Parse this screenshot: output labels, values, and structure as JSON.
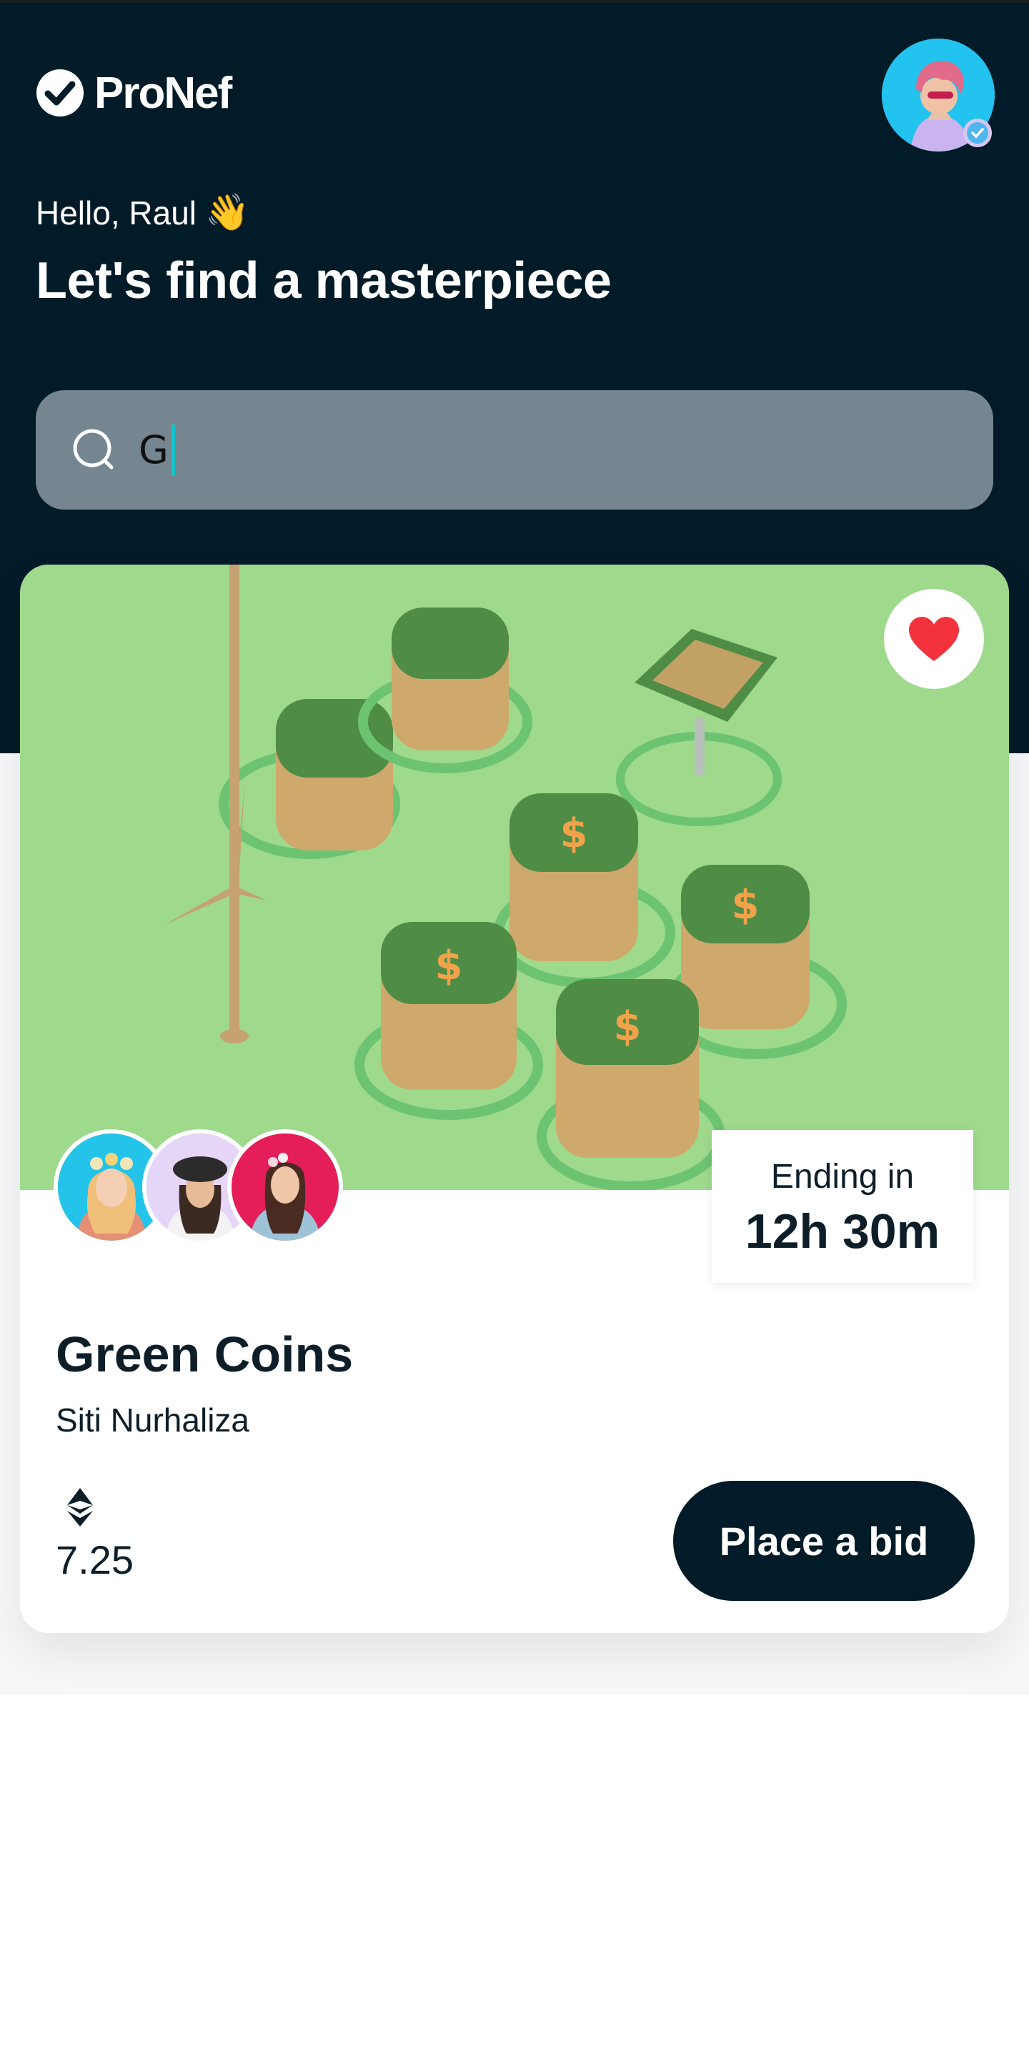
{
  "app": {
    "brand_name": "ProNef"
  },
  "header": {
    "greeting": "Hello, Raul",
    "greeting_emoji": "👋",
    "headline": "Let's find a masterpiece"
  },
  "search": {
    "value": "G"
  },
  "card": {
    "title": "Green Coins",
    "creator": "Siti Nurhaliza",
    "price": "7.25",
    "ending_label": "Ending in",
    "ending_value": "12h 30m",
    "bid_button": "Place a bid"
  },
  "colors": {
    "header_bg": "#021b28",
    "search_bg": "#758690",
    "artwork_bg": "#9ed98c",
    "like_heart": "#f2333e",
    "button_bg": "#021b28",
    "caret": "#15c3c9"
  },
  "icons": [
    "brand-check-icon",
    "search-icon",
    "heart-icon",
    "ethereum-icon",
    "verified-badge-icon"
  ]
}
